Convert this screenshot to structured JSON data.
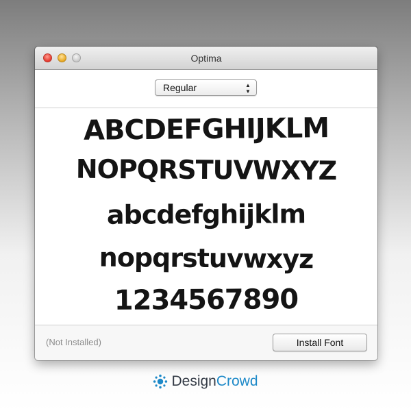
{
  "window": {
    "title": "Optima"
  },
  "toolbar": {
    "style_select": {
      "selected": "Regular"
    }
  },
  "preview": {
    "lines": [
      "ABCDEFGHIJKLM",
      "NOPQRSTUVWXYZ",
      "abcdefghijklm",
      "nopqrstuvwxyz",
      "1234567890"
    ]
  },
  "footer": {
    "status": "(Not Installed)",
    "install_button": "Install Font"
  },
  "brand": {
    "name_part1": "Design",
    "name_part2": "Crowd",
    "colors": {
      "primary": "#1d89c8",
      "text": "#333a45"
    },
    "icon": "starburst-logo-icon"
  }
}
